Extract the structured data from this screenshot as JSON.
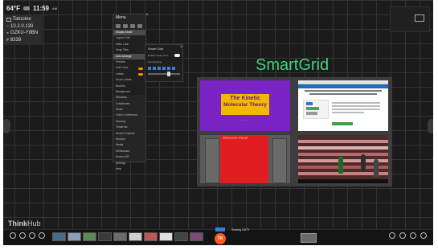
{
  "status": {
    "temperature": "64°F",
    "time": "11:59",
    "ampm": "AM"
  },
  "info_panel": {
    "room": "Tatooine",
    "ip": "10.2.0.130",
    "wifi": "GZKU-Y8BN",
    "code": "8339"
  },
  "brand": "SmartGrid",
  "logo": {
    "bold": "Think",
    "rest": "Hub"
  },
  "menu": {
    "title": "Menu",
    "items": [
      {
        "label": "Display Mode",
        "hl": true
      },
      {
        "label": "Layout Grid",
        "sub": true
      },
      {
        "label": "Ratio Lock",
        "sub": true
      },
      {
        "label": "Snap Tiles",
        "sub": true
      },
      {
        "label": "Auto Arrange",
        "sub": true,
        "hl": true
      },
      {
        "label": "Presets",
        "sub": true
      },
      {
        "label": "Grid Lines",
        "sub": true,
        "toggle": true
      },
      {
        "label": "Labels",
        "sub": true,
        "toggle": true
      },
      {
        "label": "Show Labels",
        "sub": true
      },
      {
        "label": "Borders",
        "sub": true
      },
      {
        "label": "Background",
        "sub": true
      },
      {
        "label": "Windows"
      },
      {
        "label": "Collaborate"
      },
      {
        "label": "Share"
      },
      {
        "label": "Video Conference"
      },
      {
        "label": "Sharing"
      },
      {
        "label": "ThinkHub"
      },
      {
        "label": "Screen Capture"
      },
      {
        "label": "Session"
      },
      {
        "label": "Media"
      },
      {
        "label": "Whiteboard"
      },
      {
        "label": "Screen Off"
      },
      {
        "label": "Settings"
      },
      {
        "label": "Help"
      }
    ]
  },
  "submenu": {
    "title": "Smart Grid",
    "row1": "Enable Smart Grid",
    "row2": "Grid Spacing"
  },
  "tiles": {
    "kinetic": {
      "line1": "The Kinetic",
      "line2": "Molecular Theory"
    },
    "red_label": "Welcome Panel"
  },
  "bottom": {
    "tk": "TK",
    "share_label": "Sharing  DUTY"
  },
  "colors": {
    "accent": "#41d27c",
    "orange": "#ff5a1f",
    "purple": "#7a24c5",
    "gold": "#f5b800",
    "red": "#e01e22"
  }
}
